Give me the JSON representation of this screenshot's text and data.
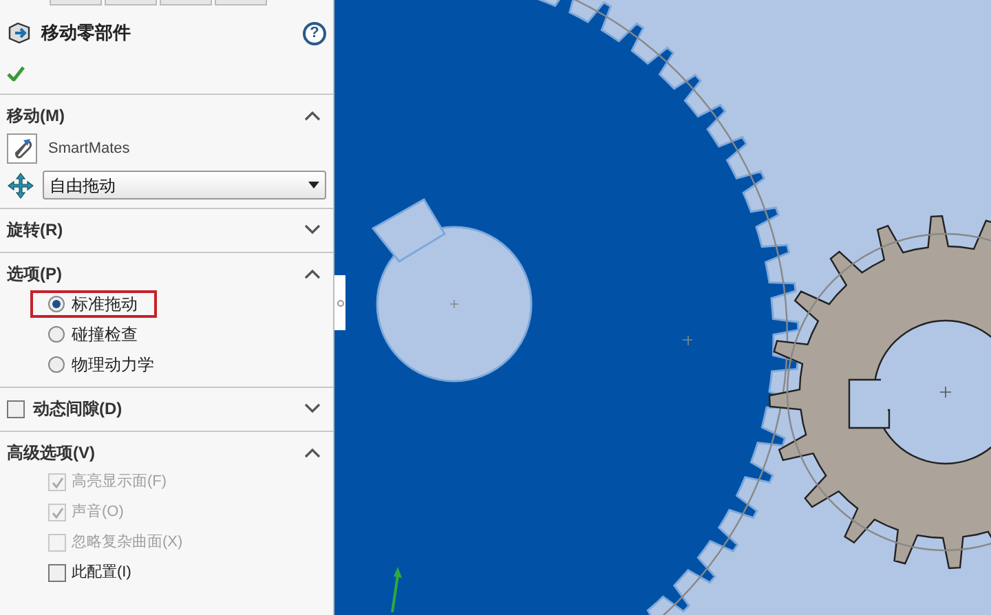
{
  "panel": {
    "title": "移动零部件",
    "help": "?"
  },
  "sections": [
    {
      "kind": "move",
      "title": "移动(M)",
      "expanded": true,
      "smartmates": "SmartMates",
      "dropdown": "自由拖动"
    },
    {
      "kind": "plain",
      "title": "旋转(R)",
      "expanded": false
    },
    {
      "kind": "radios",
      "title": "选项(P)",
      "expanded": true,
      "options": [
        {
          "label": "标准拖动",
          "selected": true,
          "highlighted": true
        },
        {
          "label": "碰撞检查",
          "selected": false,
          "highlighted": false
        },
        {
          "label": "物理动力学",
          "selected": false,
          "highlighted": false
        }
      ]
    },
    {
      "kind": "checkbox_header",
      "title": "动态间隙(D)",
      "expanded": false,
      "checked": false
    },
    {
      "kind": "checks",
      "title": "高级选项(V)",
      "expanded": true,
      "options": [
        {
          "label": "高亮显示面(F)",
          "checked": true,
          "disabled": true
        },
        {
          "label": "声音(O)",
          "checked": true,
          "disabled": true
        },
        {
          "label": "忽略复杂曲面(X)",
          "checked": false,
          "disabled": true
        },
        {
          "label": "此配置(I)",
          "checked": false,
          "disabled": false
        }
      ]
    }
  ]
}
